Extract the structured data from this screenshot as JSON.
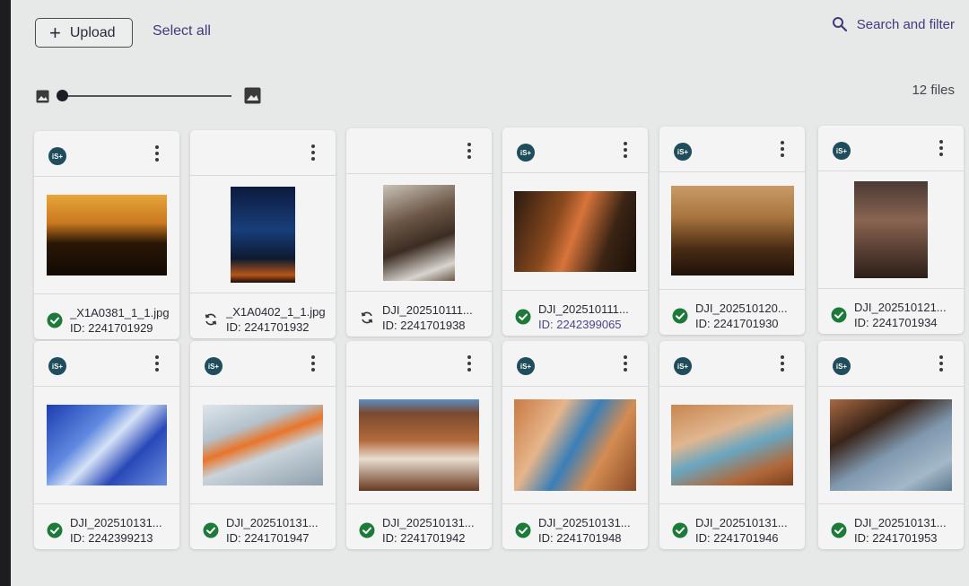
{
  "toolbar": {
    "upload_label": "Upload",
    "select_all_label": "Select all",
    "search_label": "Search and filter"
  },
  "file_count": "12 files",
  "thumb_size_slider": {
    "value": 0
  },
  "files": [
    {
      "name": "_X1A0381_1_1.jpg",
      "id": "ID: 2241701929",
      "badge": "iS+",
      "status": "done"
    },
    {
      "name": "_X1A0402_1_1.jpg",
      "id": "ID: 2241701932",
      "badge": "",
      "status": "syncing"
    },
    {
      "name": "DJI_202510111...",
      "id": "ID: 2241701938",
      "badge": "",
      "status": "syncing"
    },
    {
      "name": "DJI_202510111...",
      "id": "ID: 2242399065",
      "badge": "iS+",
      "status": "done"
    },
    {
      "name": "DJI_202510120...",
      "id": "ID: 2241701930",
      "badge": "iS+",
      "status": "done"
    },
    {
      "name": "DJI_202510121...",
      "id": "ID: 2241701934",
      "badge": "iS+",
      "status": "done"
    },
    {
      "name": "DJI_202510131...",
      "id": "ID: 2242399213",
      "badge": "iS+",
      "status": "done"
    },
    {
      "name": "DJI_202510131...",
      "id": "ID: 2241701947",
      "badge": "iS+",
      "status": "done"
    },
    {
      "name": "DJI_202510131...",
      "id": "ID: 2241701942",
      "badge": "",
      "status": "done"
    },
    {
      "name": "DJI_202510131...",
      "id": "ID: 2241701948",
      "badge": "iS+",
      "status": "done"
    },
    {
      "name": "DJI_202510131...",
      "id": "ID: 2241701946",
      "badge": "iS+",
      "status": "done"
    },
    {
      "name": "DJI_202510131...",
      "id": "ID: 2241701953",
      "badge": "iS+",
      "status": "done"
    }
  ],
  "colors": {
    "accent": "#3f3a7c",
    "status_ok": "#1e7a3a",
    "badge": "#1f4d5c"
  },
  "icons": {
    "upload": "plus-icon",
    "search": "search-icon",
    "done": "check-circle-icon",
    "syncing": "sync-icon",
    "more": "more-vertical-icon"
  }
}
